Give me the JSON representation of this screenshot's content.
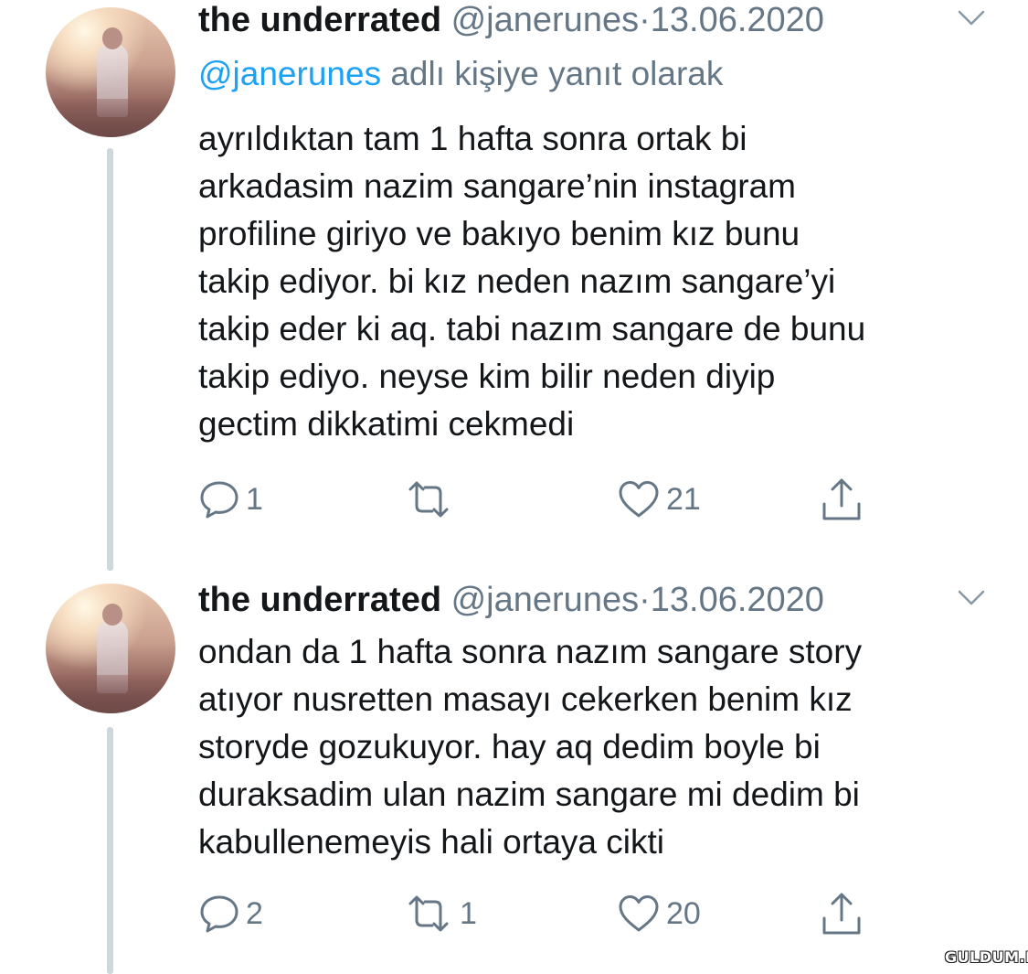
{
  "tweets": [
    {
      "display_name": "the underrated",
      "handle": "@janerunes",
      "separator": "·",
      "date": "13.06.2020",
      "reply_to": {
        "mention": "@janerunes",
        "suffix": " adlı kişiye yanıt olarak"
      },
      "lines": [
        "ayrıldıktan tam 1 hafta sonra ortak bi",
        "arkadasim nazim sangare’nin instagram",
        "profiline giriyo ve bakıyo benim kız bunu",
        "takip ediyor. bi kız neden nazım sangare’yi",
        "takip eder ki aq. tabi nazım sangare de bunu",
        "takip ediyo. neyse kim bilir neden diyip",
        "gectim dikkatimi cekmedi"
      ],
      "actions": {
        "reply_count": "1",
        "retweet_count": "",
        "like_count": "21"
      },
      "icons": [
        "reply-icon",
        "retweet-icon",
        "like-icon",
        "share-icon",
        "chevron-down-icon"
      ]
    },
    {
      "display_name": "the underrated",
      "handle": "@janerunes",
      "separator": "·",
      "date": "13.06.2020",
      "lines": [
        "ondan da 1 hafta sonra nazım sangare story",
        "atıyor nusretten masayı cekerken benim kız",
        "storyde gozukuyor. hay aq dedim boyle bi",
        "duraksadim ulan nazim sangare mi dedim bi",
        "kabullenemeyis hali ortaya cikti"
      ],
      "actions": {
        "reply_count": "2",
        "retweet_count": "1",
        "like_count": "20"
      },
      "icons": [
        "reply-icon",
        "retweet-icon",
        "like-icon",
        "share-icon",
        "chevron-down-icon"
      ]
    }
  ],
  "watermark": "GULDUM.NET",
  "colors": {
    "text": "#14171a",
    "secondary": "#657786",
    "link": "#1da1f2",
    "thread_line": "#cdd7de",
    "background": "#ffffff"
  }
}
